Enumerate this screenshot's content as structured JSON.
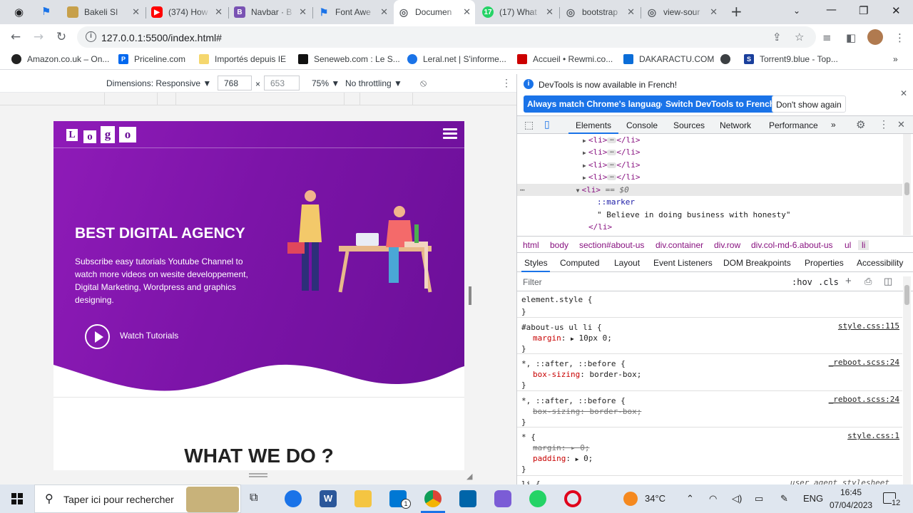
{
  "tabs": [
    {
      "title": "Bakeli SI",
      "fav_color": "#c7a04a",
      "icon": "bakeli-icon"
    },
    {
      "title": "(374) How",
      "fav_color": "#ff0000",
      "icon": "youtube-icon"
    },
    {
      "title": "Navbar · B",
      "fav_color": "#7952b3",
      "icon": "bootstrap-icon"
    },
    {
      "title": "Font Awe",
      "fav_color": "#1a73e8",
      "icon": "flag-icon"
    },
    {
      "title": "Documen",
      "fav_color": "#5f6368",
      "icon": "globe-icon",
      "active": true
    },
    {
      "title": "(17) What",
      "fav_color": "#25d366",
      "icon": "whatsapp-icon"
    },
    {
      "title": "bootstrap",
      "fav_color": "#5f6368",
      "icon": "globe-icon"
    },
    {
      "title": "view-sour",
      "fav_color": "#5f6368",
      "icon": "globe-icon"
    }
  ],
  "toolbar": {
    "url": "127.0.0.1:5500/index.html#"
  },
  "bookmarks": [
    {
      "label": "Amazon.co.uk – On...",
      "color": "#222"
    },
    {
      "label": "Priceline.com",
      "color": "#0068ef"
    },
    {
      "label": "Importés depuis IE",
      "color": "#f5c518"
    },
    {
      "label": "Seneweb.com : Le S...",
      "color": "#111"
    },
    {
      "label": "Leral.net | S'informe...",
      "color": "#1a73e8"
    },
    {
      "label": "Accueil • Rewmi.co...",
      "color": "#c00"
    },
    {
      "label": "DAKARACTU.COM",
      "color": "#0a6dd8"
    },
    {
      "label": "Torrent9.blue - Top...",
      "color": "#1a3f9c"
    }
  ],
  "device_toolbar": {
    "dimensions_label": "Dimensions: Responsive ▼",
    "width": "768",
    "times": "×",
    "height": "653",
    "zoom": "75% ▼",
    "throttle": "No throttling ▼"
  },
  "site": {
    "logo": [
      "L",
      "o",
      "g",
      "o"
    ],
    "hero_title": "BEST DIGITAL AGENCY",
    "hero_text": "Subscribe easy tutorials Youtube Channel to watch more videos on wesite developpement, Digital Marketing, Wordpress and graphics designing.",
    "watch": "Watch Tutorials",
    "section_title": "WHAT WE DO ?"
  },
  "devtools": {
    "info": "DevTools is now available in French!",
    "btn_match": "Always match Chrome's language",
    "btn_switch": "Switch DevTools to French",
    "btn_dont": "Don't show again",
    "tabs": [
      "Elements",
      "Console",
      "Sources",
      "Network",
      "Performance",
      "»"
    ],
    "dom_li": "<li>",
    "dom_li_close": "</li>",
    "dom_sel_suffix": " == $0",
    "dom_marker": "::marker",
    "dom_text": "\" Believe in doing business with honesty\"",
    "dom_close": "</li>",
    "breadcrumbs": [
      "html",
      "body",
      "section#about-us",
      "div.container",
      "div.row",
      "div.col-md-6.about-us",
      "ul",
      "li"
    ],
    "subtabs": [
      "Styles",
      "Computed",
      "Layout",
      "Event Listeners",
      "DOM Breakpoints",
      "Properties",
      "Accessibility"
    ],
    "filter_placeholder": "Filter",
    "hov": ":hov",
    "cls": ".cls",
    "rules": {
      "r0_sel": "element.style {",
      "r0_end": "}",
      "r1_sel": "#about-us ul li {",
      "r1_src": "style.css:115",
      "r1_prop": "margin",
      "r1_val": "10px 0;",
      "r1_end": "}",
      "r2_sel": "*, ::after, ::before {",
      "r2_src": "_reboot.scss:24",
      "r2_prop": "box-sizing",
      "r2_val": "border-box;",
      "r2_end": "}",
      "r3_sel": "*, ::after, ::before {",
      "r3_src": "_reboot.scss:24",
      "r3_line": "box-sizing: border-box;",
      "r3_end": "}",
      "r4_sel": "* {",
      "r4_src": "style.css:1",
      "r4_line1": "margin: ▸ 0;",
      "r4_prop2": "padding",
      "r4_val2": "0;",
      "r4_end": "}",
      "r5_sel": "li {",
      "r5_src": "user agent stylesheet"
    }
  },
  "taskbar": {
    "search": "Taper ici pour rechercher",
    "temp": "34°C",
    "lang": "ENG",
    "time": "16:45",
    "date": "07/04/2023",
    "notif": "12",
    "mail_badge": "1"
  }
}
